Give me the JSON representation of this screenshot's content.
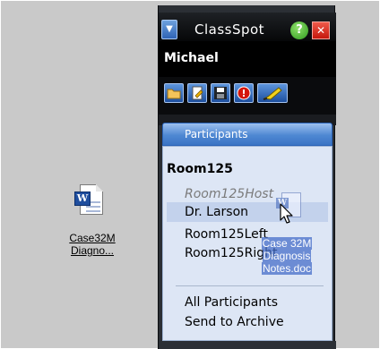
{
  "desktop": {
    "file": {
      "icon": "word-document-icon",
      "badge": "W",
      "label_lines": [
        "Case32M",
        "Diagno..."
      ]
    }
  },
  "app": {
    "title": "ClassSpot",
    "help_label": "?",
    "close_label": "✕",
    "dropdown_label": "▼",
    "user": "Michael",
    "toolbar": [
      {
        "name": "folder-icon"
      },
      {
        "name": "edit-document-icon"
      },
      {
        "name": "save-icon"
      },
      {
        "name": "alert-icon",
        "label": "!"
      },
      {
        "name": "highlighter-icon"
      }
    ],
    "tab": {
      "label": "Participants"
    },
    "room": "Room125",
    "participants": [
      {
        "label": "Room125Host",
        "state": "host"
      },
      {
        "label": "Dr. Larson",
        "state": "hovered"
      },
      {
        "label": "Room125Left",
        "state": "normal"
      },
      {
        "label": "Room125Right",
        "state": "normal"
      }
    ],
    "actions": [
      {
        "label": "All Participants"
      },
      {
        "label": "Send to Archive"
      }
    ]
  },
  "drag": {
    "icon": "word-document-icon",
    "badge": "W",
    "label_lines": [
      "Case 32M",
      "Diagnosis",
      "Notes.doc"
    ]
  },
  "colors": {
    "accent": "#3a74c4",
    "panel_dark": "#2b2f35",
    "list_bg": "#dde6f5",
    "close_red": "#c4170c",
    "help_green": "#2f9a1e"
  }
}
